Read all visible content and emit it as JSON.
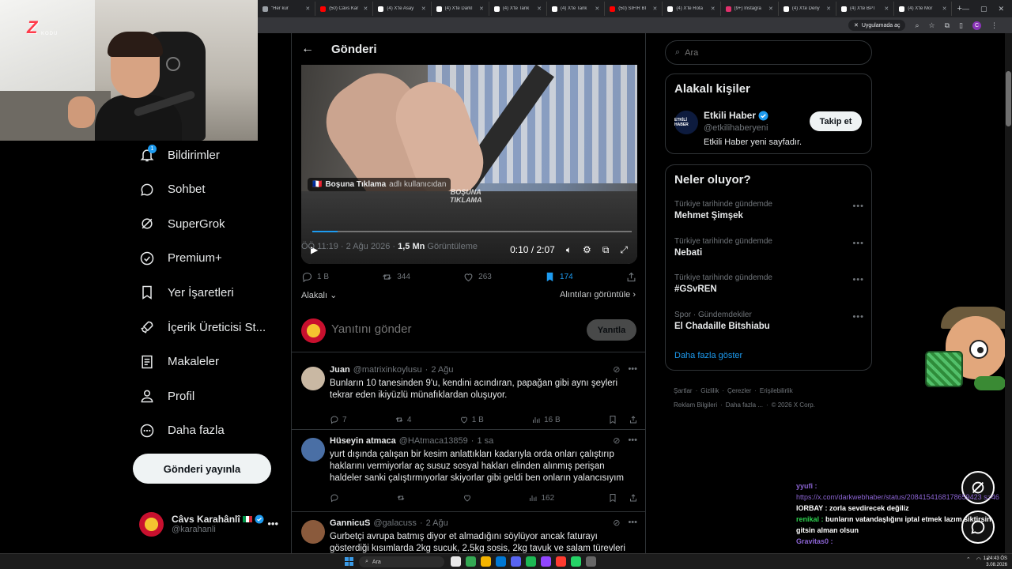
{
  "browser": {
    "tabs": [
      {
        "label": "\"Her kur",
        "color": "#9aa0a6"
      },
      {
        "label": "(50) Câvs Kar",
        "color": "#ff0000"
      },
      {
        "label": "(4) X'te Asay",
        "color": "#ffffff"
      },
      {
        "label": "(4) X'te Darkl",
        "color": "#ffffff"
      },
      {
        "label": "(4) X'te Tank",
        "color": "#ffffff"
      },
      {
        "label": "(4) X'te Tank",
        "color": "#ffffff"
      },
      {
        "label": "(50) SIFIR Bİ",
        "color": "#ff0000"
      },
      {
        "label": "(4) X'te Rota",
        "color": "#ffffff"
      },
      {
        "label": "(9+) Instagra",
        "color": "#e1306c"
      },
      {
        "label": "(4) X'te Deny",
        "color": "#ffffff"
      },
      {
        "label": "(4) X'te BPT",
        "color": "#ffffff"
      },
      {
        "label": "(4) X'te Mor",
        "color": "#ffffff"
      }
    ],
    "open_in_app": "Uygulamada aç",
    "profile_initial": "C"
  },
  "webcam": {
    "logo_text": "Z",
    "logo_sub": "KODU"
  },
  "nav": {
    "notifications_badge": "1",
    "items": [
      {
        "label": "Bildirimler",
        "icon": "bell-icon"
      },
      {
        "label": "Sohbet",
        "icon": "chat-bubble-icon"
      },
      {
        "label": "SuperGrok",
        "icon": "grok-icon"
      },
      {
        "label": "Premium+",
        "icon": "verified-badge-icon"
      },
      {
        "label": "Yer İşaretleri",
        "icon": "bookmark-icon"
      },
      {
        "label": "İçerik Üreticisi St...",
        "icon": "rocket-icon"
      },
      {
        "label": "Makaleler",
        "icon": "article-icon"
      },
      {
        "label": "Profil",
        "icon": "person-icon"
      },
      {
        "label": "Daha fazla",
        "icon": "more-circle-icon"
      }
    ],
    "post_button": "Gönderi yayınla",
    "me": {
      "name": "Câvs Karahânlî",
      "handle": "@karahanli"
    }
  },
  "main": {
    "title": "Gönderi",
    "video": {
      "attribution_name": "Boşuna Tıklama",
      "attribution_suffix": "adlı kullanıcıdan",
      "watermark_line1": "BOŞUNA",
      "watermark_line2": "TIKLAMA",
      "time": "0:10 / 2:07",
      "progress_fraction": 0.08
    },
    "meta": {
      "timestamp": "ÖÖ 11:19 · 2 Ağu 2026 ·",
      "views": "1,5 Mn",
      "views_label": "Görüntüleme"
    },
    "actions": {
      "replies": "1 B",
      "reposts": "344",
      "likes": "263",
      "bookmarks": "174"
    },
    "relevance": "Alakalı",
    "quotes_link": "Alıntıları görüntüle",
    "reply_placeholder": "Yanıtını gönder",
    "reply_button": "Yanıtla",
    "replies": [
      {
        "name": "Juan",
        "handle": "@matrixinkoylusu",
        "time": "2 Ağu",
        "text": "Bunların 10 tanesinden 9'u, kendini acındıran, papağan gibi aynı şeyleri tekrar eden ikiyüzlü münafıklardan oluşuyor.",
        "replies": "7",
        "reposts": "4",
        "likes": "1 B",
        "views": "16 B",
        "avatar_color": "#c9b8a3"
      },
      {
        "name": "Hüseyin atmaca",
        "handle": "@HAtmaca13859",
        "time": "1 sa",
        "text": "yurt dışında çalışan bir kesim anlattıkları kadarıyla orda onları çalıştırıp haklarını vermiyorlar aç susuz sosyal hakları elinden alınmış perişan haldeler sanki çalıştırmıyorlar skiyorlar gibi geldi ben onların yalancısıyım",
        "replies": "",
        "reposts": "",
        "likes": "",
        "views": "162",
        "avatar_color": "#4a6fa5"
      },
      {
        "name": "GannicuS",
        "handle": "@galacuss",
        "time": "2 Ağu",
        "text": "Gurbetçi avrupa batmış diyor et almadığını söylüyor ancak faturayı gösterdiği kısımlarda 2kg sucuk, 2.5kg sosis, 2kg tavuk ve salam türevleri",
        "avatar_color": "#8a5a3c"
      }
    ]
  },
  "right": {
    "search_placeholder": "Ara",
    "related_title": "Alakalı kişiler",
    "related_person": {
      "name": "Etkili Haber",
      "handle": "@etkilihaberyeni",
      "bio": "Etkili Haber yeni sayfadır.",
      "avatar_text": "ETKİLİ HABER",
      "follow_label": "Takip et"
    },
    "trends_title": "Neler oluyor?",
    "trends": [
      {
        "context": "Türkiye tarihinde gündemde",
        "name": "Mehmet Şimşek"
      },
      {
        "context": "Türkiye tarihinde gündemde",
        "name": "Nebati"
      },
      {
        "context": "Türkiye tarihinde gündemde",
        "name": "#GSvREN"
      },
      {
        "context": "Spor · Gündemdekiler",
        "name": "El Chadaille Bitshiabu"
      }
    ],
    "show_more": "Daha fazla göster",
    "footer": [
      "Şartlar",
      "Gizlilik",
      "Çerezler",
      "Erişilebilirlik",
      "Reklam Bilgileri",
      "Daha fazla ...",
      "© 2026 X Corp."
    ]
  },
  "chat": {
    "messages": [
      {
        "user": "yyufi :",
        "text": "",
        "link": "https://x.com/darkwebhaber/status/2084154168178659423 s=46",
        "user_style": "purple"
      },
      {
        "user": "lORBAY :",
        "text": "zorla sevdirecek değiliz",
        "user_style": "white"
      },
      {
        "user": "renikal :",
        "text": "bunların vatandaşlığını iptal etmek lazım siktirsin gitsin alman olsun",
        "user_style": "green"
      },
      {
        "user": "Gravitas0 :",
        "text": "",
        "user_style": "purple"
      }
    ]
  },
  "taskbar": {
    "search": "Ara",
    "clock_time": "1:24:43 ÖS",
    "clock_date": "3.08.2026"
  }
}
